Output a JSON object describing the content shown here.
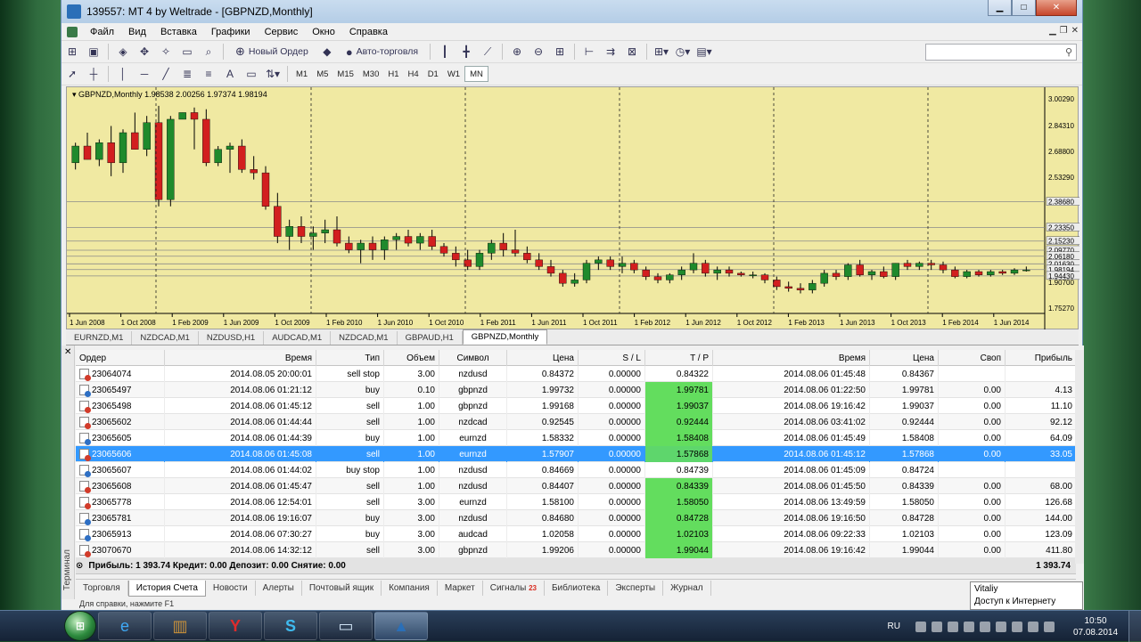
{
  "window": {
    "title": "139557: MT 4 by Weltrade - [GBPNZD,Monthly]"
  },
  "menu": [
    "Файл",
    "Вид",
    "Вставка",
    "Графики",
    "Сервис",
    "Окно",
    "Справка"
  ],
  "toolbar": {
    "new_order": "Новый Ордер",
    "autotrading": "Авто-торговля"
  },
  "timeframes": [
    "M1",
    "M5",
    "M15",
    "M30",
    "H1",
    "H4",
    "D1",
    "W1",
    "MN"
  ],
  "active_timeframe": "MN",
  "chart": {
    "header": "GBPNZD,Monthly  1.98538 2.00256 1.97374 1.98194",
    "bull_color": "#1f8a2c",
    "bear_color": "#d21f1f",
    "bg_color": "#f0e9a2"
  },
  "chart_data": {
    "type": "candlestick",
    "symbol": "GBPNZD",
    "x_ticks": [
      "1 Jun 2008",
      "1 Oct 2008",
      "1 Feb 2009",
      "1 Jun 2009",
      "1 Oct 2009",
      "1 Feb 2010",
      "1 Jun 2010",
      "1 Oct 2010",
      "1 Feb 2011",
      "1 Jun 2011",
      "1 Oct 2011",
      "1 Feb 2012",
      "1 Jun 2012",
      "1 Oct 2012",
      "1 Feb 2013",
      "1 Jun 2013",
      "1 Oct 2013",
      "1 Feb 2014",
      "1 Jun 2014"
    ],
    "y_ticks": [
      "3.00290",
      "2.84310",
      "2.68800",
      "2.53290",
      "2.38680",
      "2.23350",
      "2.15230",
      "2.09770",
      "2.06180",
      "2.01630",
      "1.98194",
      "1.94430",
      "1.90700",
      "1.75270"
    ],
    "ylim": [
      1.72,
      3.05
    ],
    "candles": [
      [
        2.62,
        2.74,
        2.58,
        2.72
      ],
      [
        2.72,
        2.8,
        2.64,
        2.64
      ],
      [
        2.64,
        2.76,
        2.6,
        2.74
      ],
      [
        2.74,
        2.84,
        2.54,
        2.62
      ],
      [
        2.62,
        2.82,
        2.56,
        2.8
      ],
      [
        2.8,
        2.92,
        2.7,
        2.7
      ],
      [
        2.7,
        2.9,
        2.66,
        2.86
      ],
      [
        2.86,
        2.96,
        2.36,
        2.4
      ],
      [
        2.4,
        2.9,
        2.36,
        2.88
      ],
      [
        2.88,
        2.92,
        2.88,
        2.92
      ],
      [
        2.92,
        2.95,
        2.7,
        2.88
      ],
      [
        2.88,
        2.94,
        2.6,
        2.62
      ],
      [
        2.62,
        2.72,
        2.6,
        2.7
      ],
      [
        2.7,
        2.74,
        2.56,
        2.72
      ],
      [
        2.72,
        2.76,
        2.56,
        2.58
      ],
      [
        2.58,
        2.66,
        2.52,
        2.56
      ],
      [
        2.56,
        2.6,
        2.34,
        2.36
      ],
      [
        2.36,
        2.44,
        2.14,
        2.18
      ],
      [
        2.18,
        2.28,
        2.1,
        2.24
      ],
      [
        2.24,
        2.3,
        2.14,
        2.18
      ],
      [
        2.18,
        2.24,
        2.1,
        2.2
      ],
      [
        2.2,
        2.28,
        2.14,
        2.22
      ],
      [
        2.22,
        2.3,
        2.12,
        2.14
      ],
      [
        2.14,
        2.18,
        2.08,
        2.1
      ],
      [
        2.1,
        2.16,
        2.02,
        2.14
      ],
      [
        2.14,
        2.18,
        2.04,
        2.1
      ],
      [
        2.1,
        2.18,
        2.04,
        2.16
      ],
      [
        2.16,
        2.2,
        2.1,
        2.18
      ],
      [
        2.18,
        2.22,
        2.12,
        2.14
      ],
      [
        2.14,
        2.2,
        2.1,
        2.18
      ],
      [
        2.18,
        2.22,
        2.1,
        2.12
      ],
      [
        2.12,
        2.14,
        2.06,
        2.08
      ],
      [
        2.08,
        2.12,
        2.0,
        2.04
      ],
      [
        2.04,
        2.1,
        1.98,
        2.0
      ],
      [
        2.0,
        2.1,
        1.98,
        2.08
      ],
      [
        2.08,
        2.16,
        2.04,
        2.14
      ],
      [
        2.14,
        2.2,
        2.06,
        2.1
      ],
      [
        2.1,
        2.22,
        2.06,
        2.08
      ],
      [
        2.08,
        2.12,
        2.02,
        2.04
      ],
      [
        2.04,
        2.08,
        1.98,
        2.0
      ],
      [
        2.0,
        2.04,
        1.94,
        1.96
      ],
      [
        1.96,
        1.98,
        1.88,
        1.9
      ],
      [
        1.9,
        1.96,
        1.88,
        1.92
      ],
      [
        1.92,
        2.04,
        1.9,
        2.02
      ],
      [
        2.02,
        2.06,
        1.98,
        2.04
      ],
      [
        2.04,
        2.06,
        1.98,
        2.0
      ],
      [
        2.0,
        2.06,
        1.96,
        2.02
      ],
      [
        2.02,
        2.04,
        1.96,
        1.98
      ],
      [
        1.98,
        2.0,
        1.92,
        1.94
      ],
      [
        1.94,
        1.96,
        1.9,
        1.92
      ],
      [
        1.92,
        1.96,
        1.9,
        1.95
      ],
      [
        1.95,
        2.0,
        1.92,
        1.98
      ],
      [
        1.98,
        2.08,
        1.96,
        2.02
      ],
      [
        2.02,
        2.04,
        1.94,
        1.96
      ],
      [
        1.96,
        2.0,
        1.92,
        1.98
      ],
      [
        1.98,
        2.0,
        1.94,
        1.96
      ],
      [
        1.96,
        1.97,
        1.94,
        1.95
      ],
      [
        1.95,
        1.97,
        1.93,
        1.95
      ],
      [
        1.95,
        1.96,
        1.9,
        1.92
      ],
      [
        1.92,
        1.94,
        1.86,
        1.88
      ],
      [
        1.88,
        1.91,
        1.85,
        1.87
      ],
      [
        1.87,
        1.9,
        1.84,
        1.86
      ],
      [
        1.86,
        1.92,
        1.84,
        1.9
      ],
      [
        1.9,
        1.98,
        1.88,
        1.96
      ],
      [
        1.96,
        1.98,
        1.92,
        1.94
      ],
      [
        1.94,
        2.02,
        1.92,
        2.01
      ],
      [
        2.01,
        2.04,
        1.94,
        1.95
      ],
      [
        1.95,
        1.98,
        1.92,
        1.97
      ],
      [
        1.97,
        2.0,
        1.93,
        1.94
      ],
      [
        1.94,
        2.02,
        1.92,
        2.02
      ],
      [
        2.02,
        2.04,
        1.98,
        2.0
      ],
      [
        2.0,
        2.03,
        1.98,
        2.02
      ],
      [
        2.02,
        2.04,
        1.98,
        2.01
      ],
      [
        2.01,
        2.03,
        1.96,
        1.98
      ],
      [
        1.98,
        2.0,
        1.93,
        1.94
      ],
      [
        1.94,
        1.98,
        1.93,
        1.97
      ],
      [
        1.97,
        1.98,
        1.94,
        1.95
      ],
      [
        1.95,
        1.98,
        1.94,
        1.97
      ],
      [
        1.97,
        1.98,
        1.95,
        1.96
      ],
      [
        1.96,
        1.99,
        1.95,
        1.98
      ],
      [
        1.98,
        2.0,
        1.97,
        1.98
      ]
    ]
  },
  "chart_tabs": [
    "EURNZD,M1",
    "NZDCAD,M1",
    "NZDUSD,H1",
    "AUDCAD,M1",
    "NZDCAD,M1",
    "GBPAUD,H1",
    "GBPNZD,Monthly"
  ],
  "active_chart_tab": "GBPNZD,Monthly",
  "terminal": {
    "side_label": "Терминал",
    "columns": [
      "Ордер",
      "Время",
      "Тип",
      "Объем",
      "Символ",
      "Цена",
      "S / L",
      "T / P",
      "Время",
      "Цена",
      "Своп",
      "Прибыль"
    ],
    "rows": [
      {
        "order": "23064074",
        "open_time": "2014.08.05 20:00:01",
        "type": "sell stop",
        "volume": "3.00",
        "symbol": "nzdusd",
        "price": "0.84372",
        "sl": "0.00000",
        "tp": "0.84322",
        "close_time": "2014.08.06 01:45:48",
        "close_price": "0.84367",
        "swap": "",
        "profit": "",
        "tp_hit": false,
        "side": "sell"
      },
      {
        "order": "23065497",
        "open_time": "2014.08.06 01:21:12",
        "type": "buy",
        "volume": "0.10",
        "symbol": "gbpnzd",
        "price": "1.99732",
        "sl": "0.00000",
        "tp": "1.99781",
        "close_time": "2014.08.06 01:22:50",
        "close_price": "1.99781",
        "swap": "0.00",
        "profit": "4.13",
        "tp_hit": true,
        "side": "buy"
      },
      {
        "order": "23065498",
        "open_time": "2014.08.06 01:45:12",
        "type": "sell",
        "volume": "1.00",
        "symbol": "gbpnzd",
        "price": "1.99168",
        "sl": "0.00000",
        "tp": "1.99037",
        "close_time": "2014.08.06 19:16:42",
        "close_price": "1.99037",
        "swap": "0.00",
        "profit": "11.10",
        "tp_hit": true,
        "side": "sell"
      },
      {
        "order": "23065602",
        "open_time": "2014.08.06 01:44:44",
        "type": "sell",
        "volume": "1.00",
        "symbol": "nzdcad",
        "price": "0.92545",
        "sl": "0.00000",
        "tp": "0.92444",
        "close_time": "2014.08.06 03:41:02",
        "close_price": "0.92444",
        "swap": "0.00",
        "profit": "92.12",
        "tp_hit": true,
        "side": "sell"
      },
      {
        "order": "23065605",
        "open_time": "2014.08.06 01:44:39",
        "type": "buy",
        "volume": "1.00",
        "symbol": "eurnzd",
        "price": "1.58332",
        "sl": "0.00000",
        "tp": "1.58408",
        "close_time": "2014.08.06 01:45:49",
        "close_price": "1.58408",
        "swap": "0.00",
        "profit": "64.09",
        "tp_hit": true,
        "side": "buy"
      },
      {
        "order": "23065606",
        "open_time": "2014.08.06 01:45:08",
        "type": "sell",
        "volume": "1.00",
        "symbol": "eurnzd",
        "price": "1.57907",
        "sl": "0.00000",
        "tp": "1.57868",
        "close_time": "2014.08.06 01:45:12",
        "close_price": "1.57868",
        "swap": "0.00",
        "profit": "33.05",
        "tp_hit": true,
        "side": "sell",
        "selected": true
      },
      {
        "order": "23065607",
        "open_time": "2014.08.06 01:44:02",
        "type": "buy stop",
        "volume": "1.00",
        "symbol": "nzdusd",
        "price": "0.84669",
        "sl": "0.00000",
        "tp": "0.84739",
        "close_time": "2014.08.06 01:45:09",
        "close_price": "0.84724",
        "swap": "",
        "profit": "",
        "tp_hit": false,
        "side": "buy"
      },
      {
        "order": "23065608",
        "open_time": "2014.08.06 01:45:47",
        "type": "sell",
        "volume": "1.00",
        "symbol": "nzdusd",
        "price": "0.84407",
        "sl": "0.00000",
        "tp": "0.84339",
        "close_time": "2014.08.06 01:45:50",
        "close_price": "0.84339",
        "swap": "0.00",
        "profit": "68.00",
        "tp_hit": true,
        "side": "sell"
      },
      {
        "order": "23065778",
        "open_time": "2014.08.06 12:54:01",
        "type": "sell",
        "volume": "3.00",
        "symbol": "eurnzd",
        "price": "1.58100",
        "sl": "0.00000",
        "tp": "1.58050",
        "close_time": "2014.08.06 13:49:59",
        "close_price": "1.58050",
        "swap": "0.00",
        "profit": "126.68",
        "tp_hit": true,
        "side": "sell"
      },
      {
        "order": "23065781",
        "open_time": "2014.08.06 19:16:07",
        "type": "buy",
        "volume": "3.00",
        "symbol": "nzdusd",
        "price": "0.84680",
        "sl": "0.00000",
        "tp": "0.84728",
        "close_time": "2014.08.06 19:16:50",
        "close_price": "0.84728",
        "swap": "0.00",
        "profit": "144.00",
        "tp_hit": true,
        "side": "buy"
      },
      {
        "order": "23065913",
        "open_time": "2014.08.06 07:30:27",
        "type": "buy",
        "volume": "3.00",
        "symbol": "audcad",
        "price": "1.02058",
        "sl": "0.00000",
        "tp": "1.02103",
        "close_time": "2014.08.06 09:22:33",
        "close_price": "1.02103",
        "swap": "0.00",
        "profit": "123.09",
        "tp_hit": true,
        "side": "buy"
      },
      {
        "order": "23070670",
        "open_time": "2014.08.06 14:32:12",
        "type": "sell",
        "volume": "3.00",
        "symbol": "gbpnzd",
        "price": "1.99206",
        "sl": "0.00000",
        "tp": "1.99044",
        "close_time": "2014.08.06 19:16:42",
        "close_price": "1.99044",
        "swap": "0.00",
        "profit": "411.80",
        "tp_hit": true,
        "side": "sell"
      }
    ],
    "summary": "Прибыль: 1 393.74  Кредит: 0.00  Депозит: 0.00  Снятие: 0.00",
    "summary_total": "1 393.74",
    "tabs": [
      "Торговля",
      "История Счета",
      "Новости",
      "Алерты",
      "Почтовый ящик",
      "Компания",
      "Маркет",
      "Сигналы",
      "Библиотека",
      "Эксперты",
      "Журнал"
    ],
    "active_tab": "История Счета",
    "signals_badge": "23"
  },
  "statusbar": {
    "help": "Для справки, нажмите F1"
  },
  "tooltip": {
    "name": "Vitaliy",
    "status": "Доступ к Интернету"
  },
  "taskbar": {
    "lang": "RU",
    "time": "10:50",
    "date": "07.08.2014"
  }
}
